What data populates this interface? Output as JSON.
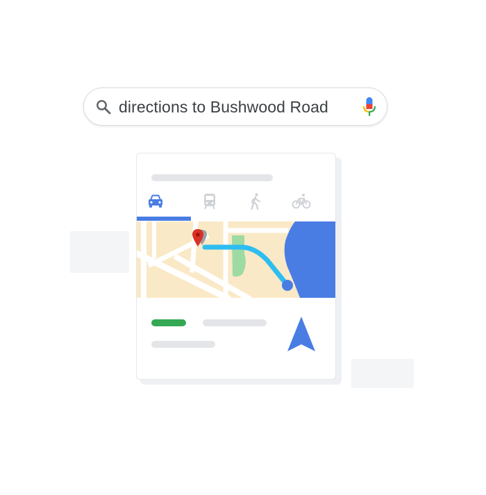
{
  "search": {
    "query": "directions to Bushwood Road",
    "icon": "search-icon",
    "voice_icon": "mic-icon"
  },
  "directions_card": {
    "travel_modes": [
      {
        "name": "driving",
        "icon": "car-icon",
        "active": true
      },
      {
        "name": "transit",
        "icon": "train-icon",
        "active": false
      },
      {
        "name": "walking",
        "icon": "walking-icon",
        "active": false
      },
      {
        "name": "cycling",
        "icon": "bike-icon",
        "active": false
      }
    ],
    "navigate_icon": "navigation-arrow-icon"
  },
  "colors": {
    "accent_blue": "#4a7de4",
    "route": "#2ebdf1",
    "eta_green": "#34a853",
    "map_land": "#fae9c6",
    "map_water": "#4a7de4",
    "park": "#9edba3",
    "pin_red": "#d93025",
    "placeholder": "#e3e5e8"
  }
}
